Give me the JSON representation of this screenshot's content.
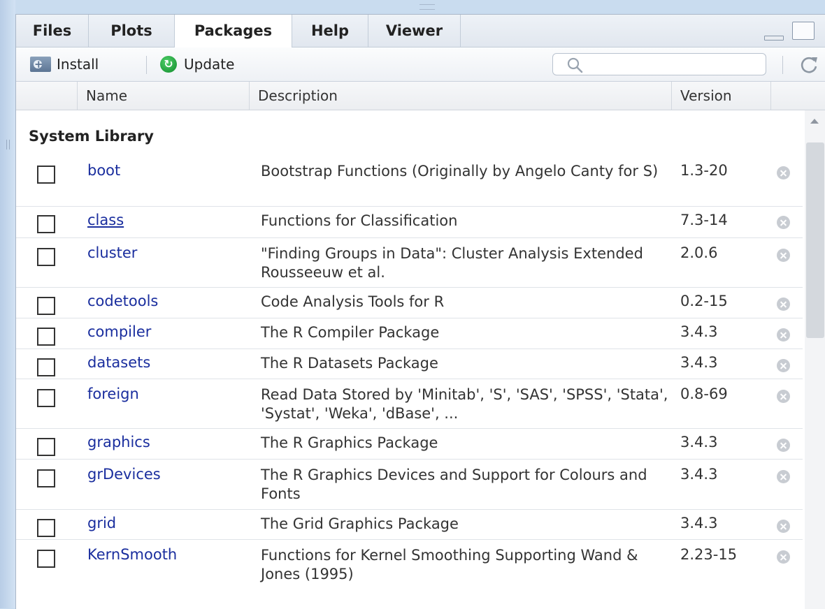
{
  "tabs": [
    {
      "label": "Files",
      "active": false
    },
    {
      "label": "Plots",
      "active": false
    },
    {
      "label": "Packages",
      "active": true
    },
    {
      "label": "Help",
      "active": false
    },
    {
      "label": "Viewer",
      "active": false
    }
  ],
  "toolbar": {
    "install_label": "Install",
    "update_label": "Update",
    "search_placeholder": ""
  },
  "columns": {
    "name": "Name",
    "description": "Description",
    "version": "Version"
  },
  "section_label": "System Library",
  "packages": [
    {
      "name": "boot",
      "description": "Bootstrap Functions (Originally by Angelo Canty for S)",
      "version": "1.3-20",
      "checked": false,
      "underlined": false
    },
    {
      "name": "class",
      "description": "Functions for Classification",
      "version": "7.3-14",
      "checked": false,
      "underlined": true
    },
    {
      "name": "cluster",
      "description": "\"Finding Groups in Data\": Cluster Analysis Extended Rousseeuw et al.",
      "version": "2.0.6",
      "checked": false,
      "underlined": false
    },
    {
      "name": "codetools",
      "description": "Code Analysis Tools for R",
      "version": "0.2-15",
      "checked": false,
      "underlined": false
    },
    {
      "name": "compiler",
      "description": "The R Compiler Package",
      "version": "3.4.3",
      "checked": false,
      "underlined": false
    },
    {
      "name": "datasets",
      "description": "The R Datasets Package",
      "version": "3.4.3",
      "checked": false,
      "underlined": false
    },
    {
      "name": "foreign",
      "description": "Read Data Stored by 'Minitab', 'S', 'SAS', 'SPSS', 'Stata', 'Systat', 'Weka', 'dBase', ...",
      "version": "0.8-69",
      "checked": false,
      "underlined": false
    },
    {
      "name": "graphics",
      "description": "The R Graphics Package",
      "version": "3.4.3",
      "checked": false,
      "underlined": false
    },
    {
      "name": "grDevices",
      "description": "The R Graphics Devices and Support for Colours and Fonts",
      "version": "3.4.3",
      "checked": false,
      "underlined": false
    },
    {
      "name": "grid",
      "description": "The Grid Graphics Package",
      "version": "3.4.3",
      "checked": false,
      "underlined": false
    },
    {
      "name": "KernSmooth",
      "description": "Functions for Kernel Smoothing Supporting Wand & Jones (1995)",
      "version": "2.23-15",
      "checked": false,
      "underlined": false
    }
  ],
  "colors": {
    "package_link": "#1a2e9e",
    "update_green": "#1fa33c"
  }
}
